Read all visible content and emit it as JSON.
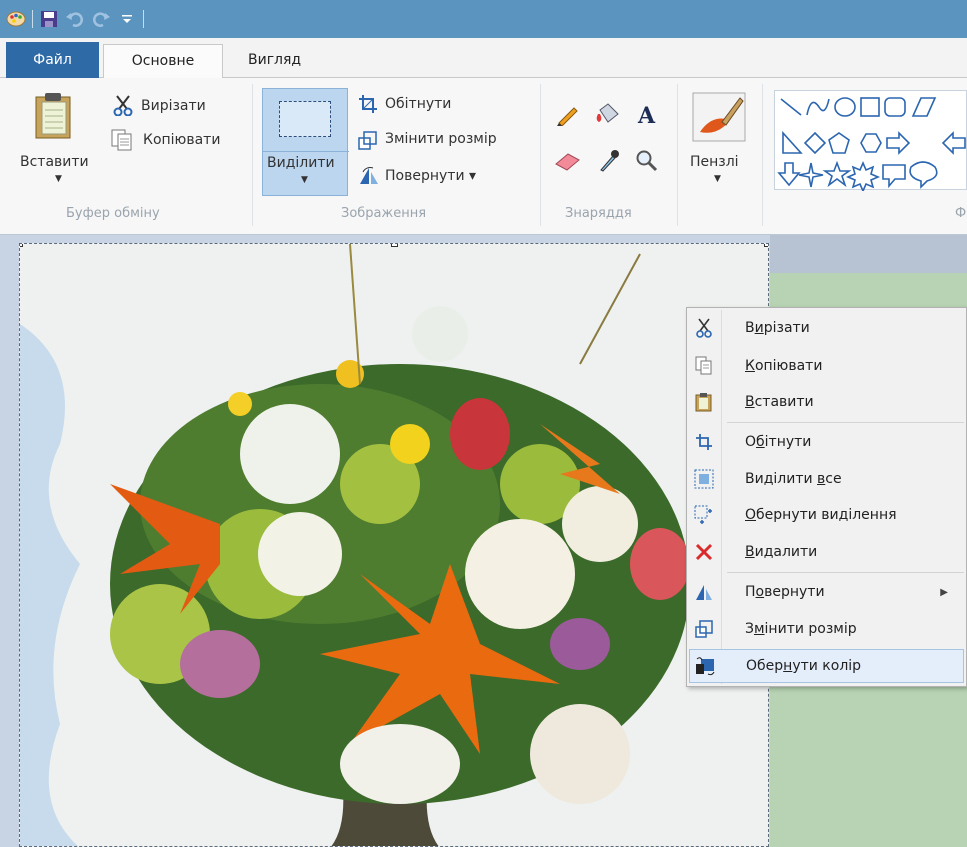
{
  "qat": {
    "icons": [
      "paint-icon",
      "save-icon",
      "undo-icon",
      "redo-icon",
      "customize-icon"
    ]
  },
  "tabs": {
    "file": "Файл",
    "home": "Основне",
    "view": "Вигляд"
  },
  "ribbon": {
    "clipboard": {
      "paste": "Вставити",
      "cut": "Вирізати",
      "copy": "Копіювати",
      "label": "Буфер обміну"
    },
    "image": {
      "select": "Виділити",
      "crop": "Обітнути",
      "resize": "Змінити розмір",
      "rotate": "Повернути ▾",
      "label": "Зображення"
    },
    "tools": {
      "label": "Знаряддя"
    },
    "brushes": {
      "label": "Пензлі"
    },
    "shapes": {
      "label": "Ф"
    }
  },
  "context_menu": {
    "items": [
      {
        "pre": "В",
        "u": "и",
        "post": "різати",
        "icon": "scissors-icon"
      },
      {
        "pre": "",
        "u": "К",
        "post": "опіювати",
        "icon": "copy-icon"
      },
      {
        "pre": "",
        "u": "В",
        "post": "ставити",
        "icon": "paste-icon"
      },
      {
        "pre": "О",
        "u": "б",
        "post": "ітнути",
        "icon": "crop-icon"
      },
      {
        "pre": "Виділити ",
        "u": "в",
        "post": "се",
        "icon": "select-all-icon"
      },
      {
        "pre": "",
        "u": "О",
        "post": "бернути виділення",
        "icon": "invert-selection-icon"
      },
      {
        "pre": "",
        "u": "В",
        "post": "идалити",
        "icon": "delete-icon"
      },
      {
        "pre": "П",
        "u": "о",
        "post": "вернути",
        "icon": "rotate-icon"
      },
      {
        "pre": "З",
        "u": "м",
        "post": "інити розмір",
        "icon": "resize-icon"
      },
      {
        "pre": "Обер",
        "u": "н",
        "post": "ути колір",
        "icon": "invert-color-icon"
      }
    ]
  }
}
